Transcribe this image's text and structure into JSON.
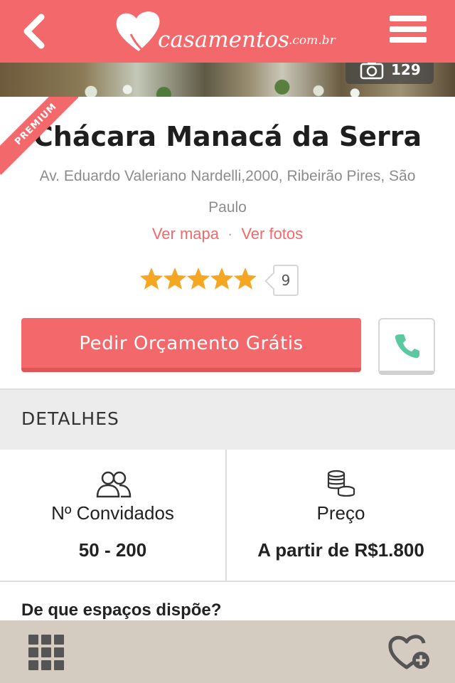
{
  "header": {
    "logo_text": "casamentos",
    "logo_domain": ".com.br"
  },
  "hero": {
    "photo_count": "129"
  },
  "listing": {
    "badge": "PREMIUM",
    "title": "Chácara Manacá da Serra",
    "address": "Av. Eduardo Valeriano Nardelli,2000, Ribeirão Pires, São Paulo",
    "link_map": "Ver mapa",
    "link_separator": "·",
    "link_photos": "Ver fotos",
    "rating_stars": 5,
    "review_count": "9",
    "quote_button": "Pedir Orçamento Grátis"
  },
  "details": {
    "heading": "DETALHES",
    "guests_label": "Nº Convidados",
    "guests_value": "50 - 200",
    "price_label": "Preço",
    "price_value": "A partir de R$1.800"
  },
  "question": "De que espaços dispõe?",
  "colors": {
    "brand": "#f2686b",
    "star": "#f5a623",
    "phone": "#5bc8a0",
    "bottom_bar": "#d4ccc0"
  },
  "icons": [
    "back-arrow-icon",
    "heart-logo-icon",
    "hamburger-menu-icon",
    "camera-icon",
    "star-icon",
    "phone-icon",
    "guests-icon",
    "coins-icon",
    "grid-icon",
    "heart-plus-icon"
  ]
}
